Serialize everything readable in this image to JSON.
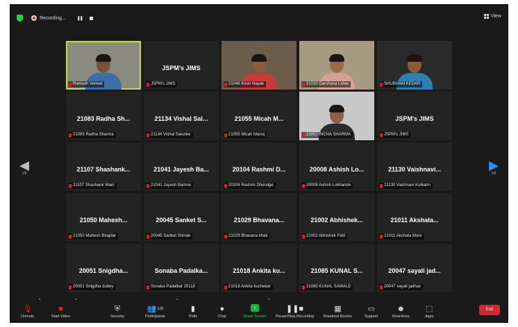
{
  "topbar": {
    "recording_label": "Recording...",
    "view_label": "View"
  },
  "nav": {
    "left_page": "1/6",
    "right_page": "1/6"
  },
  "tiles": [
    {
      "big": "",
      "tag": "Ramesh Venkat",
      "kind": "video",
      "active": true,
      "skin": "#7a5238",
      "shirt": "#3b6fa8",
      "bg": "#8a8a80"
    },
    {
      "big": "JSPM's JIMS",
      "tag": "JSPM's JIMS",
      "kind": "name"
    },
    {
      "big": "",
      "tag": "21048 Kiran Nayak",
      "kind": "video",
      "skin": "#8a5a3c",
      "shirt": "#c83a3a",
      "bg": "#6e5c4a"
    },
    {
      "big": "",
      "tag": "21030 Darshana Lohar",
      "kind": "video",
      "skin": "#9a6a4a",
      "shirt": "#d8a090",
      "bg": "#a89a80"
    },
    {
      "big": "",
      "tag": "SHUBHAM KEDAR",
      "kind": "video",
      "skin": "#8a5a3a",
      "shirt": "#2f7fb0",
      "bg": "#2a2a2a"
    },
    {
      "big": "21083 Radha Sh...",
      "tag": "21083 Radha Sharma",
      "kind": "name"
    },
    {
      "big": "21134 Vishal Sal...",
      "tag": "21134 Vishal Salunke",
      "kind": "name"
    },
    {
      "big": "21055 Micah M...",
      "tag": "21055 Micah Manoj",
      "kind": "name"
    },
    {
      "big": "",
      "tag": "21007 RICHA SHARMA",
      "kind": "video",
      "skin": "#8a6048",
      "shirt": "#2b2b2b",
      "bg": "#c8c8c8"
    },
    {
      "big": "JSPM's JIMS",
      "tag": "JSPM's JIMS",
      "kind": "name"
    },
    {
      "big": "21107 Shashank...",
      "tag": "21107 Shashank Wani",
      "kind": "name"
    },
    {
      "big": "21041 Jayesh Ba...",
      "tag": "21041 Jayesh Bamne",
      "kind": "name"
    },
    {
      "big": "20104 Rashmi D...",
      "tag": "20104 Rashmi Dhondge",
      "kind": "name"
    },
    {
      "big": "20008 Ashish Lo...",
      "tag": "20008 Ashish Lokhande",
      "kind": "name"
    },
    {
      "big": "21130 Vaishnavi...",
      "tag": "21130 Vaishnavi Kulkarni",
      "kind": "name"
    },
    {
      "big": "21050 Mahesh...",
      "tag": "21050 Mahesh Birajdar",
      "kind": "name"
    },
    {
      "big": "20045 Sanket S...",
      "tag": "20045 Sanket Shinde",
      "kind": "name"
    },
    {
      "big": "21029 Bhavana...",
      "tag": "21029 Bhavana khati",
      "kind": "name"
    },
    {
      "big": "21002 Abhishek...",
      "tag": "21002 Abhishek Patil",
      "kind": "name"
    },
    {
      "big": "21011 Akshata...",
      "tag": "21011 Akshata  More",
      "kind": "name"
    },
    {
      "big": "20051 Snigdha...",
      "tag": "20051 Snigdha dubey",
      "kind": "name"
    },
    {
      "big": "Sonaba Padalka...",
      "tag": "Sonaba Padalkar 20118",
      "kind": "name"
    },
    {
      "big": "21018 Ankita ku...",
      "tag": "21018 Ankita kuchekar",
      "kind": "name"
    },
    {
      "big": "21085 KUNAL S...",
      "tag": "21085 KUNAL SAWALE",
      "kind": "name"
    },
    {
      "big": "20047 sayali jad...",
      "tag": "20047 sayali jadhav",
      "kind": "name"
    }
  ],
  "toolbar": {
    "unmute": "Unmute",
    "start_video": "Start Video",
    "security": "Security",
    "participants": "Participants",
    "participants_count": "128",
    "polls": "Polls",
    "chat": "Chat",
    "share_screen": "Share Screen",
    "pause_stop_recording": "Pause/Stop Recording",
    "breakout_rooms": "Breakout Rooms",
    "support": "Support",
    "reactions": "Reactions",
    "apps": "Apps",
    "end": "End"
  },
  "colors": {
    "accent_blue": "#2d8cff",
    "share_green": "#12b43c",
    "end_red": "#d9272e",
    "active_speaker": "#c8e02a"
  }
}
